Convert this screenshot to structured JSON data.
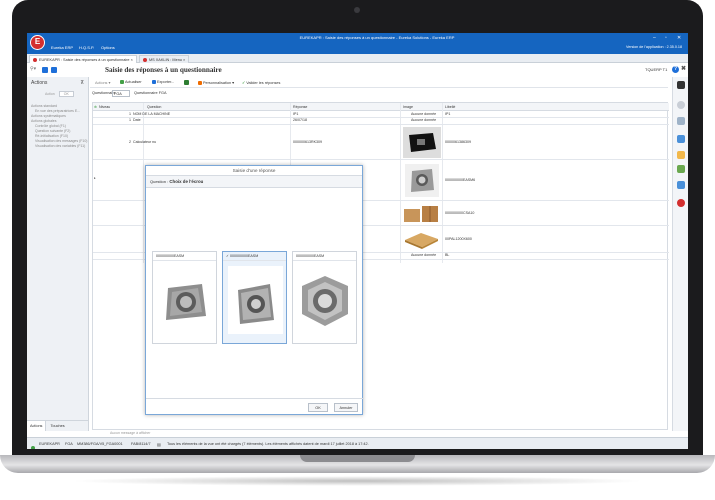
{
  "window": {
    "title": "EUREKAPR : Saisie des réponses à un questionnaire - Eureka Solutions - Eureka ERP",
    "menu": [
      "Eureka ERP",
      "H.Q.S.P.",
      "Options"
    ],
    "version": "Version de l'application : 2.35.0.18"
  },
  "doc_tabs": [
    {
      "label": "EUREKAPR : Saisie des réponses à un questionnaire"
    },
    {
      "label": "MS XAKLIN : Menu"
    }
  ],
  "header": {
    "page_title": "Saisie des réponses à un questionnaire",
    "ref": "TQUERP T1"
  },
  "sidebar": {
    "title": "Actions",
    "filter_label": "Action",
    "filter_button": "OK",
    "items": [
      {
        "label": "Actions standard",
        "sub": false
      },
      {
        "label": "En vue des préparatrices E...",
        "sub": true
      },
      {
        "label": "Actions systématiques",
        "sub": false
      },
      {
        "label": "Actions globales",
        "sub": false
      },
      {
        "label": "Contrôle global (F1)",
        "sub": true
      },
      {
        "label": "Question suivante (F2)",
        "sub": true
      },
      {
        "label": "Ré-initialisation (F10)",
        "sub": true
      },
      {
        "label": "Visualisation des messages (F10)",
        "sub": true
      },
      {
        "label": "Visualisation des variables (F11)",
        "sub": true
      }
    ],
    "bottom_tabs": [
      "Actions",
      "Touches"
    ]
  },
  "toolbar": {
    "actions": "Actions",
    "refresh": "Actualiser",
    "export": "Exporter...",
    "personalize": "Personnalisation",
    "validate": "Valider les réponses"
  },
  "questionnaire": {
    "label": "Questionnaire",
    "value": "FGA",
    "name": "Questionnaire FGA"
  },
  "grid": {
    "columns": [
      "Niveau",
      "Question",
      "Réponse",
      "Image",
      "Libellé"
    ],
    "rows": [
      {
        "level": "1",
        "question": "NOM DE LA MACHINE",
        "answer": "IP1",
        "image": "Aucune donnée",
        "label": "IP1"
      },
      {
        "level": "1",
        "question": "Date",
        "answer": "26/07/18",
        "image": "Aucune donnée",
        "label": ""
      },
      {
        "level": "2",
        "question": "Calculateur nu",
        "answer": "000000613RK309",
        "image": "",
        "label": "0000061386309"
      },
      {
        "level": "",
        "question": "",
        "answer": "",
        "image": "",
        "label": "000000000EASM6"
      },
      {
        "level": "",
        "question": "",
        "answer": "",
        "image": "",
        "label": "000000000CSA10"
      },
      {
        "level": "",
        "question": "",
        "answer": "",
        "image": "",
        "label": "00PAL1200X600"
      },
      {
        "level": "",
        "question": "",
        "answer": "",
        "image": "Aucune donnée",
        "label": "BL"
      }
    ]
  },
  "dialog": {
    "title": "Saisie d'une réponse",
    "question_label": "Question :",
    "question": "Choix de l'écrou",
    "options": [
      {
        "label": "000000000EASM",
        "selected": false
      },
      {
        "label": "000000000EASM",
        "selected": true
      },
      {
        "label": "000000000EASM",
        "selected": false
      }
    ],
    "ok": "OK",
    "cancel": "Annuler"
  },
  "status": {
    "message": "Aucun message à afficher",
    "app": "EUREKAPR",
    "company": "FGA",
    "path": "MM386/FGA/V5_FGA0001",
    "code": "FAB/8114/7",
    "info": "Tous les éléments de la vue ont été chargés (7 éléments). Les éléments affichés datent de mardi 17 juillet 2018 à 17:42."
  },
  "colors": {
    "titlebar": "#1565c0",
    "logo": "#d32f2f",
    "accent": "#1e6fd9"
  }
}
